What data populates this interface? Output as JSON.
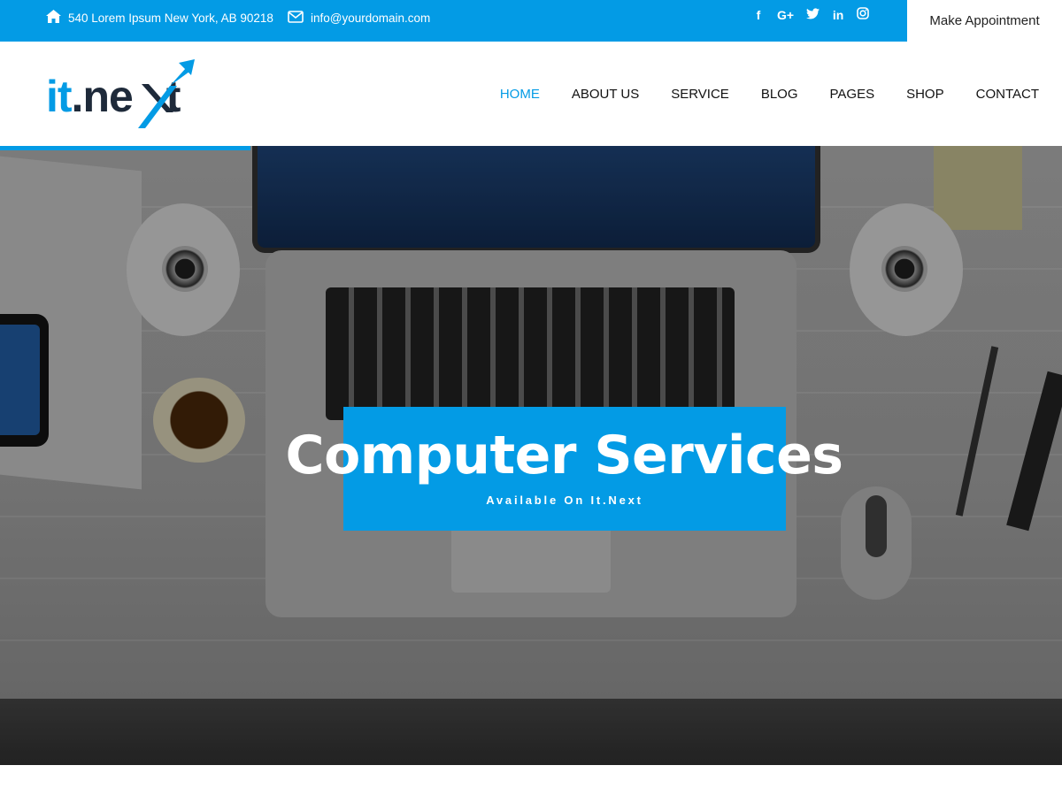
{
  "topbar": {
    "address": "540 Lorem Ipsum New York, AB 90218",
    "email": "info@yourdomain.com",
    "social": {
      "facebook": "f",
      "google_plus": "G+",
      "twitter": "t",
      "linkedin": "in",
      "instagram": "◎"
    },
    "appointment_label": "Make Appointment"
  },
  "logo": {
    "part1": "it",
    "part2": ".ne",
    "part3": "t"
  },
  "nav": {
    "items": [
      "HOME",
      "ABOUT US",
      "SERVICE",
      "BLOG",
      "PAGES",
      "SHOP",
      "CONTACT"
    ],
    "active": "HOME"
  },
  "hero": {
    "title": "Computer Services",
    "subtitle": "Available On It.Next"
  },
  "colors": {
    "brand": "#039be5",
    "dark": "#1e2a3a"
  }
}
